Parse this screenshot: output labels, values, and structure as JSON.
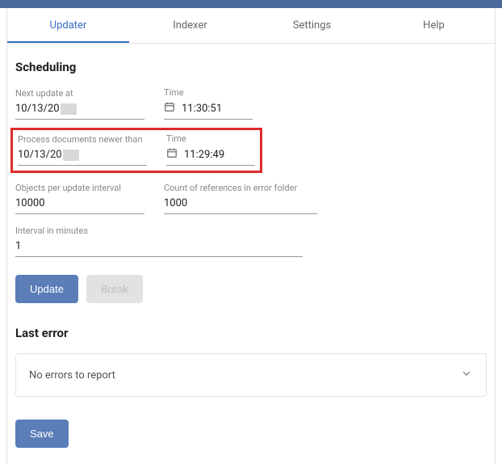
{
  "tabs": {
    "updater": "Updater",
    "indexer": "Indexer",
    "settings": "Settings",
    "help": "Help"
  },
  "sections": {
    "scheduling": "Scheduling",
    "last_error": "Last error"
  },
  "fields": {
    "next_update_at_label": "Next update at",
    "next_update_at_date": "10/13/20",
    "next_update_at_time_label": "Time",
    "next_update_at_time": "11:30:51",
    "process_newer_label": "Process documents newer than",
    "process_newer_date": "10/13/20",
    "process_newer_time_label": "Time",
    "process_newer_time": "11:29:49",
    "objects_per_interval_label": "Objects per update interval",
    "objects_per_interval_value": "10000",
    "error_folder_count_label": "Count of references in error folder",
    "error_folder_count_value": "1000",
    "interval_minutes_label": "Interval in minutes",
    "interval_minutes_value": "1"
  },
  "buttons": {
    "update": "Update",
    "break": "Break",
    "save": "Save"
  },
  "last_error_text": "No errors to report"
}
